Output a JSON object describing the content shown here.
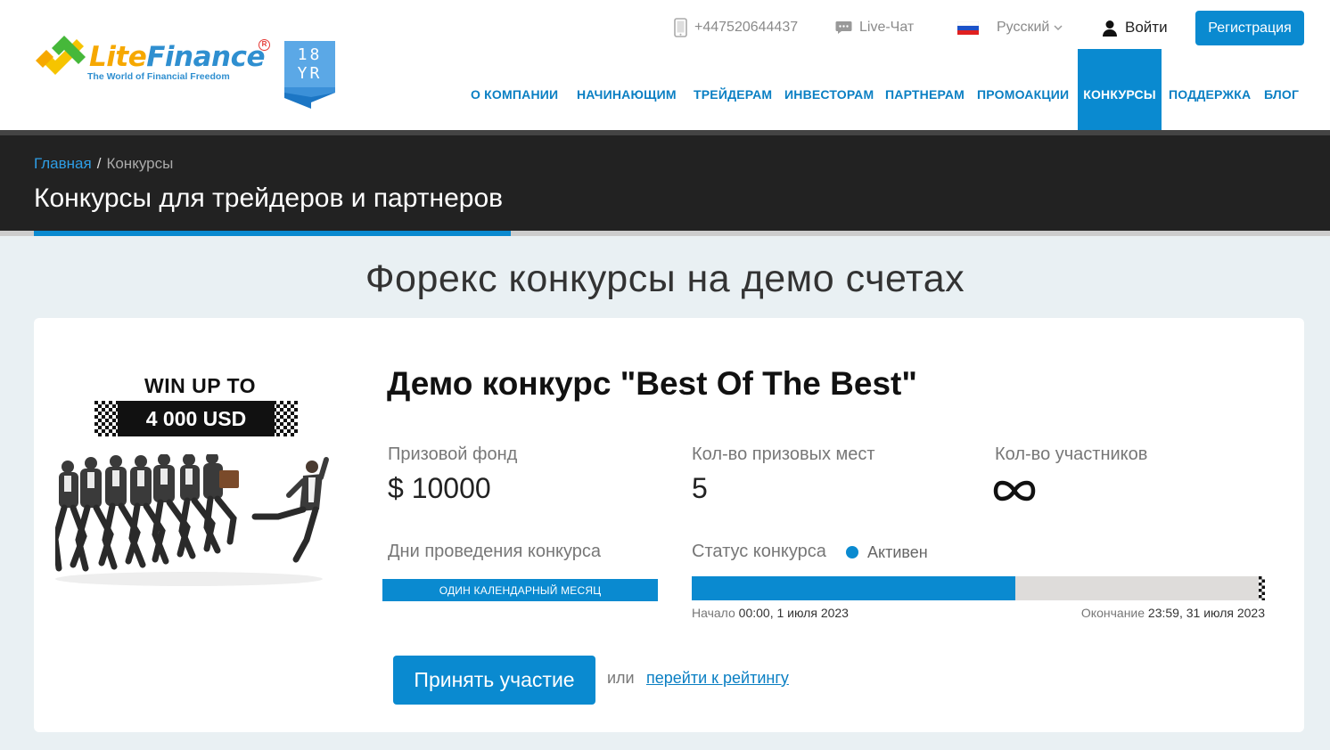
{
  "header": {
    "logo": {
      "name_part1": "Lite",
      "name_part2": "Finance",
      "tagline": "The World of Financial Freedom",
      "badge_line1": "18",
      "badge_line2": "YR"
    },
    "phone": "+447520644437",
    "chat_label": "Live-Чат",
    "language": "Русский",
    "login_label": "Войти",
    "register_label": "Регистрация",
    "nav": [
      {
        "label": "О КОМПАНИИ"
      },
      {
        "label": "НАЧИНАЮЩИМ"
      },
      {
        "label": "ТРЕЙДЕРАМ"
      },
      {
        "label": "ИНВЕСТОРАМ"
      },
      {
        "label": "ПАРТНЕРАМ"
      },
      {
        "label": "ПРОМОАКЦИИ"
      },
      {
        "label": "КОНКУРСЫ",
        "active": true
      },
      {
        "label": "ПОДДЕРЖКА"
      },
      {
        "label": "БЛОГ"
      }
    ]
  },
  "breadcrumb": {
    "home": "Главная",
    "separator": "/",
    "current": "Конкурсы"
  },
  "page_title": "Конкурсы для трейдеров и партнеров",
  "section_title": "Форекс конкурсы на демо счетах",
  "contest": {
    "promo_line1": "WIN UP TO",
    "promo_amount": "4 000 USD",
    "title": "Демо конкурс \"Best Of The Best\"",
    "prize_fund_label": "Призовой фонд",
    "prize_fund_value": "$ 10000",
    "prize_places_label": "Кол-во призовых мест",
    "prize_places_value": "5",
    "participants_label": "Кол-во участников",
    "participants_value": "unlimited (infinity-icon)",
    "days_label": "Дни проведения конкурса",
    "days_value": "ОДИН КАЛЕНДАРНЫЙ МЕСЯЦ",
    "status_label": "Статус конкурса",
    "status_value": "Активен",
    "progress_fraction": 0.565,
    "start_label": "Начало",
    "start_value": "00:00, 1 июля 2023",
    "end_label": "Окончание",
    "end_value": "23:59, 31 июля 2023",
    "join_label": "Принять участие",
    "or_label": "или",
    "rating_link": "перейти к рейтингу"
  },
  "colors": {
    "accent": "#0a8ad0",
    "logo_orange": "#f6a800",
    "logo_blue": "#2f8fd0",
    "dark_band": "#222222",
    "page_bg": "#e9f0f3"
  }
}
